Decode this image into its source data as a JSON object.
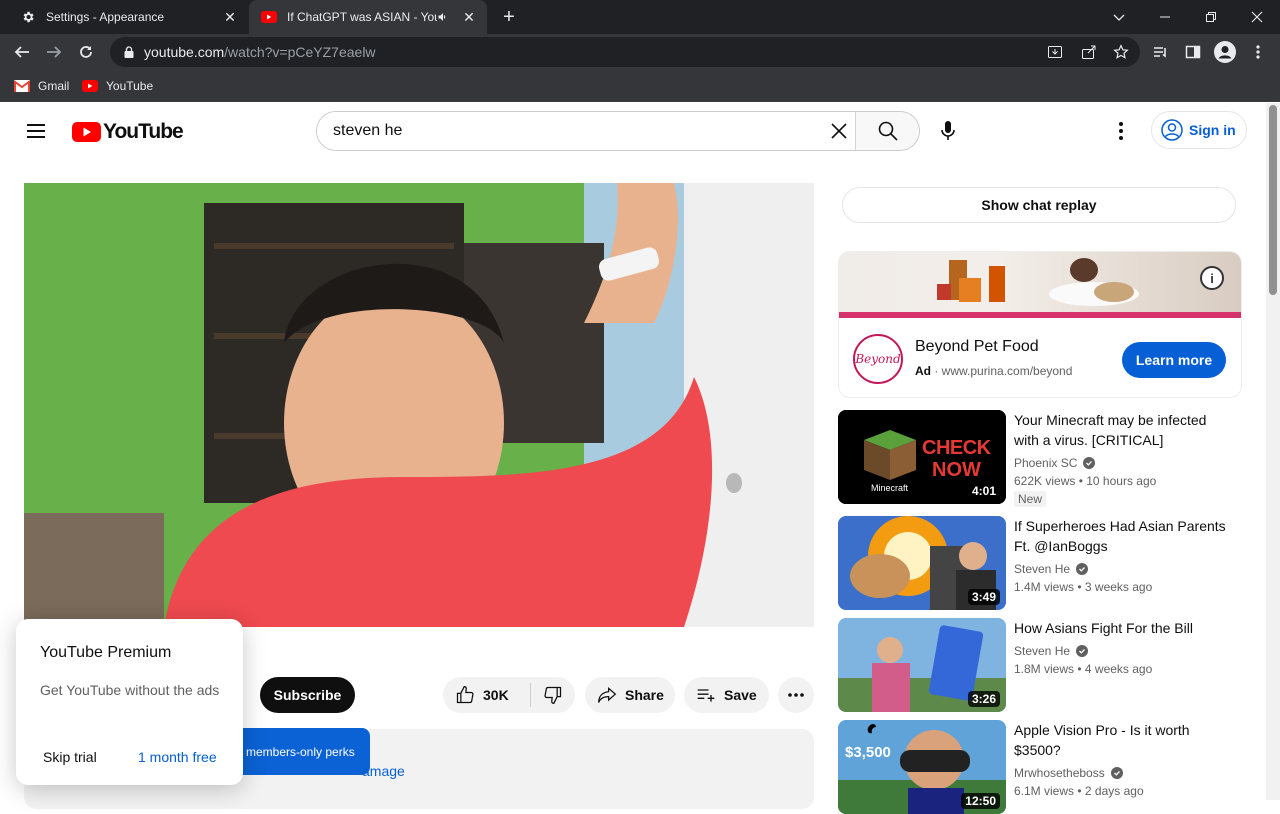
{
  "browser": {
    "tabs": [
      {
        "title": "Settings - Appearance",
        "icon": "gear-icon"
      },
      {
        "title": "If ChatGPT was ASIAN - YouTube",
        "icon": "youtube-icon"
      }
    ],
    "url_domain": "youtube.com",
    "url_path": "/watch?v=pCeYZ7eaelw",
    "bookmarks": [
      {
        "label": "Gmail",
        "icon": "gmail-icon"
      },
      {
        "label": "YouTube",
        "icon": "youtube-icon"
      }
    ]
  },
  "masthead": {
    "logo_text": "YouTube",
    "search_value": "steven he",
    "signin_label": "Sign in"
  },
  "player": {
    "subscribe_label": "Subscribe",
    "likes": "30K",
    "share_label": "Share",
    "save_label": "Save",
    "members_label": "members-only perks",
    "manage_label": "amage"
  },
  "premium_popup": {
    "title": "YouTube Premium",
    "description": "Get YouTube without the ads",
    "skip_label": "Skip trial",
    "free_label": "1 month free"
  },
  "sidebar": {
    "chat_replay_label": "Show chat replay",
    "ad": {
      "name": "Beyond Pet Food",
      "ad_label": "Ad",
      "url": "www.purina.com/beyond",
      "cta": "Learn more",
      "logo_text": "Beyond"
    },
    "recommendations": [
      {
        "title": "Your Minecraft may be infected with a virus. [CRITICAL]",
        "channel": "Phoenix SC",
        "views": "622K views",
        "age": "10 hours ago",
        "duration": "4:01",
        "badge": "New",
        "thumb_text_1": "CHECK",
        "thumb_text_2": "NOW",
        "thumb_text_3": "Minecraft"
      },
      {
        "title": "If Superheroes Had Asian Parents Ft. @IanBoggs",
        "channel": "Steven He",
        "views": "1.4M views",
        "age": "3 weeks ago",
        "duration": "3:49"
      },
      {
        "title": "How Asians Fight For the Bill",
        "channel": "Steven He",
        "views": "1.8M views",
        "age": "4 weeks ago",
        "duration": "3:26"
      },
      {
        "title": "Apple Vision Pro - Is it worth $3500?",
        "channel": "Mrwhosetheboss",
        "views": "6.1M views",
        "age": "2 days ago",
        "duration": "12:50",
        "thumb_text_1": "$3,500"
      }
    ]
  },
  "colors": {
    "youtube_red": "#ff0000",
    "link_blue": "#065fd4",
    "chrome_dark": "#202124",
    "chrome_toolbar": "#35363a"
  }
}
